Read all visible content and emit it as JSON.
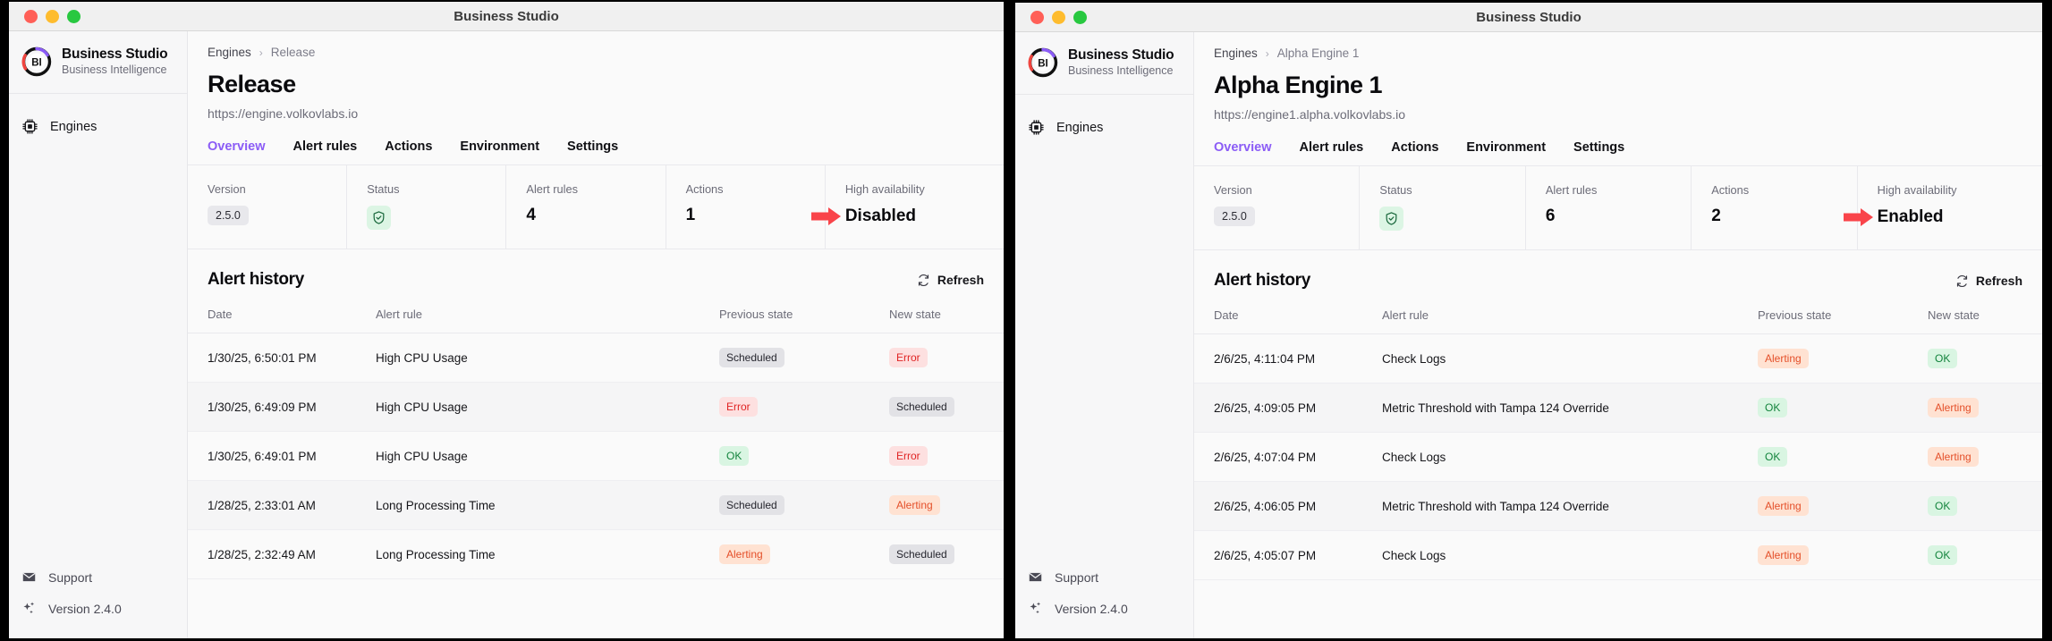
{
  "windows": [
    {
      "id": "left",
      "titlebar": {
        "title": "Business Studio"
      },
      "sidebar": {
        "brand": {
          "title": "Business Studio",
          "subtitle": "Business Intelligence",
          "logo_icon": "bi-logo-icon"
        },
        "items": [
          {
            "label": "Engines",
            "icon": "cpu-chip-icon"
          }
        ],
        "footer": [
          {
            "label": "Support",
            "icon": "envelope-icon"
          },
          {
            "label": "Version 2.4.0",
            "icon": "sparkles-icon"
          }
        ]
      },
      "breadcrumb": {
        "root": "Engines",
        "separator": "›",
        "current": "Release"
      },
      "page": {
        "title": "Release",
        "url": "https://engine.volkovlabs.io"
      },
      "tabs": [
        {
          "label": "Overview",
          "active": true
        },
        {
          "label": "Alert rules",
          "active": false
        },
        {
          "label": "Actions",
          "active": false
        },
        {
          "label": "Environment",
          "active": false
        },
        {
          "label": "Settings",
          "active": false
        }
      ],
      "stats": [
        {
          "label": "Version",
          "value": "2.5.0",
          "kind": "chip"
        },
        {
          "label": "Status",
          "value": "",
          "kind": "shield",
          "icon": "shield-check-icon"
        },
        {
          "label": "Alert rules",
          "value": "4",
          "kind": "number"
        },
        {
          "label": "Actions",
          "value": "1",
          "kind": "number"
        },
        {
          "label": "High availability",
          "value": "Disabled",
          "kind": "arrow-text",
          "icon": "red-arrow-icon"
        }
      ],
      "alert_history": {
        "title": "Alert history",
        "refresh_label": "Refresh",
        "refresh_icon": "refresh-icon",
        "columns": [
          "Date",
          "Alert rule",
          "Previous state",
          "New state"
        ],
        "rows": [
          {
            "date": "1/30/25, 6:50:01 PM",
            "rule": "High CPU Usage",
            "prev": "Scheduled",
            "prev_kind": "scheduled",
            "new": "Error",
            "new_kind": "error"
          },
          {
            "date": "1/30/25, 6:49:09 PM",
            "rule": "High CPU Usage",
            "prev": "Error",
            "prev_kind": "error",
            "new": "Scheduled",
            "new_kind": "scheduled"
          },
          {
            "date": "1/30/25, 6:49:01 PM",
            "rule": "High CPU Usage",
            "prev": "OK",
            "prev_kind": "ok",
            "new": "Error",
            "new_kind": "error"
          },
          {
            "date": "1/28/25, 2:33:01 AM",
            "rule": "Long Processing Time",
            "prev": "Scheduled",
            "prev_kind": "scheduled",
            "new": "Alerting",
            "new_kind": "alerting"
          },
          {
            "date": "1/28/25, 2:32:49 AM",
            "rule": "Long Processing Time",
            "prev": "Alerting",
            "prev_kind": "alerting",
            "new": "Scheduled",
            "new_kind": "scheduled"
          }
        ]
      }
    },
    {
      "id": "right",
      "titlebar": {
        "title": "Business Studio"
      },
      "sidebar": {
        "brand": {
          "title": "Business Studio",
          "subtitle": "Business Intelligence",
          "logo_icon": "bi-logo-icon"
        },
        "items": [
          {
            "label": "Engines",
            "icon": "cpu-chip-icon"
          }
        ],
        "footer": [
          {
            "label": "Support",
            "icon": "envelope-icon"
          },
          {
            "label": "Version 2.4.0",
            "icon": "sparkles-icon"
          }
        ]
      },
      "breadcrumb": {
        "root": "Engines",
        "separator": "›",
        "current": "Alpha Engine 1"
      },
      "page": {
        "title": "Alpha Engine 1",
        "url": "https://engine1.alpha.volkovlabs.io"
      },
      "tabs": [
        {
          "label": "Overview",
          "active": true
        },
        {
          "label": "Alert rules",
          "active": false
        },
        {
          "label": "Actions",
          "active": false
        },
        {
          "label": "Environment",
          "active": false
        },
        {
          "label": "Settings",
          "active": false
        }
      ],
      "stats": [
        {
          "label": "Version",
          "value": "2.5.0",
          "kind": "chip"
        },
        {
          "label": "Status",
          "value": "",
          "kind": "shield",
          "icon": "shield-check-icon"
        },
        {
          "label": "Alert rules",
          "value": "6",
          "kind": "number"
        },
        {
          "label": "Actions",
          "value": "2",
          "kind": "number"
        },
        {
          "label": "High availability",
          "value": "Enabled",
          "kind": "arrow-text",
          "icon": "red-arrow-icon"
        }
      ],
      "alert_history": {
        "title": "Alert history",
        "refresh_label": "Refresh",
        "refresh_icon": "refresh-icon",
        "columns": [
          "Date",
          "Alert rule",
          "Previous state",
          "New state"
        ],
        "rows": [
          {
            "date": "2/6/25, 4:11:04 PM",
            "rule": "Check Logs",
            "prev": "Alerting",
            "prev_kind": "alerting",
            "new": "OK",
            "new_kind": "ok"
          },
          {
            "date": "2/6/25, 4:09:05 PM",
            "rule": "Metric Threshold with Tampa 124 Override",
            "prev": "OK",
            "prev_kind": "ok",
            "new": "Alerting",
            "new_kind": "alerting"
          },
          {
            "date": "2/6/25, 4:07:04 PM",
            "rule": "Check Logs",
            "prev": "OK",
            "prev_kind": "ok",
            "new": "Alerting",
            "new_kind": "alerting"
          },
          {
            "date": "2/6/25, 4:06:05 PM",
            "rule": "Metric Threshold with Tampa 124 Override",
            "prev": "Alerting",
            "prev_kind": "alerting",
            "new": "OK",
            "new_kind": "ok"
          },
          {
            "date": "2/6/25, 4:05:07 PM",
            "rule": "Check Logs",
            "prev": "Alerting",
            "prev_kind": "alerting",
            "new": "OK",
            "new_kind": "ok"
          }
        ]
      }
    }
  ],
  "colors": {
    "accent_purple": "#8b5cf6",
    "arrow_red": "#f9444a",
    "ok_green": "#12833c",
    "error_red": "#e02424",
    "alerting_orange": "#e4502a"
  }
}
